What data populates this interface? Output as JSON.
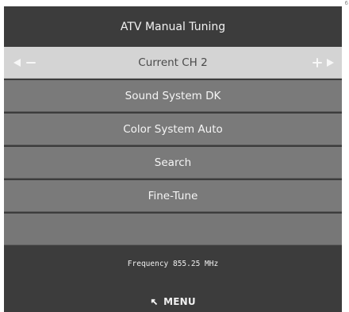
{
  "page": {
    "corner_mark": "6"
  },
  "header": {
    "title": "ATV Manual Tuning"
  },
  "menu": {
    "items": [
      {
        "label": "Current CH 2",
        "selected": true,
        "left_icons": [
          "left-arrow-icon",
          "minus-icon"
        ],
        "right_icons": [
          "plus-icon",
          "right-arrow-icon"
        ]
      },
      {
        "label": "Sound System DK",
        "selected": false
      },
      {
        "label": "Color System Auto",
        "selected": false
      },
      {
        "label": "Search",
        "selected": false
      },
      {
        "label": "Fine-Tune",
        "selected": false
      },
      {
        "label": "",
        "selected": false
      }
    ]
  },
  "footer": {
    "frequency": "Frequency 855.25 MHz",
    "menu_label": "MENU",
    "menu_icon": "return-arrow-icon"
  },
  "colors": {
    "background": "#3c3c3c",
    "selected_row": "#d4d4d4",
    "row": "#7a7a7a",
    "text": "#f5f5f5"
  }
}
